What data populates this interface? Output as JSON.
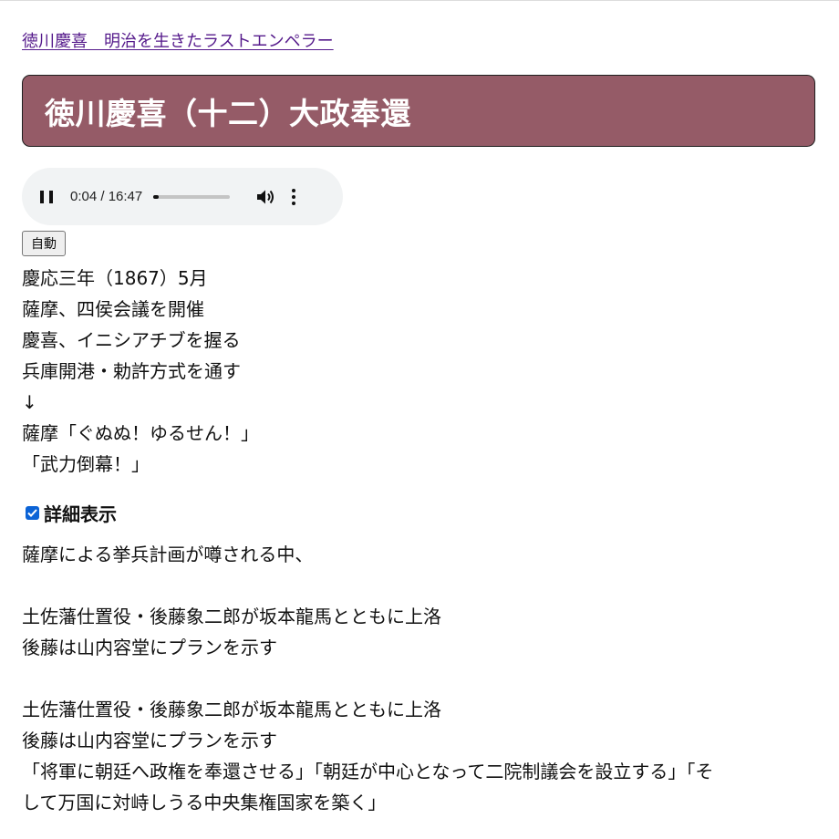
{
  "header": {
    "breadcrumb_link": "徳川慶喜　明治を生きたラストエンペラー"
  },
  "title": "徳川慶喜（十二）大政奉還",
  "colors": {
    "banner_bg": "#955b67",
    "link": "#551a8b",
    "checkbox": "#0b63d6"
  },
  "audio": {
    "time": "0:04 / 16:47",
    "progress_fraction": 0.004,
    "icons": [
      "pause-icon",
      "volume-icon",
      "more-vert-icon"
    ]
  },
  "controls": {
    "auto_label": "自動"
  },
  "summary_lines": [
    "慶応三年（1867）5月",
    "薩摩、四侯会議を開催",
    "慶喜、イニシアチブを握る",
    "兵庫開港・勅許方式を通す",
    "↓",
    "薩摩「ぐぬぬ！ゆるせん！」",
    "「武力倒幕！」"
  ],
  "detail": {
    "toggle_label": "詳細表示",
    "checked": true,
    "paragraphs": [
      {
        "lines": [
          "薩摩による挙兵計画が噂される中、"
        ]
      },
      {
        "lines": [
          "土佐藩仕置役・後藤象二郎が坂本龍馬とともに上洛",
          "後藤は山内容堂にプランを示す"
        ]
      },
      {
        "lines": [
          "土佐藩仕置役・後藤象二郎が坂本龍馬とともに上洛",
          "後藤は山内容堂にプランを示す",
          "「将軍に朝廷へ政権を奉還させる」「朝廷が中心となって二院制議会を設立する」「そ",
          "して万国に対峙しうる中央集権国家を築く」"
        ]
      }
    ]
  }
}
